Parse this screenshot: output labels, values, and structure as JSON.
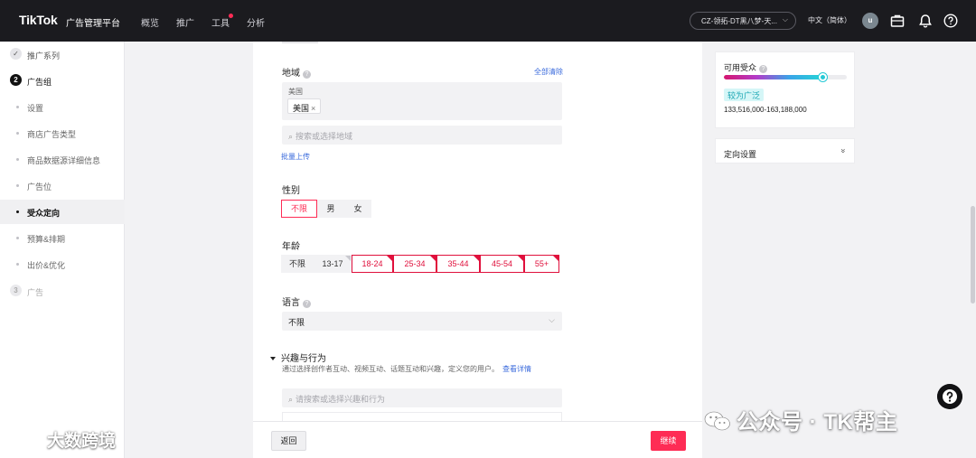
{
  "topbar": {
    "logo": "TikTok",
    "logo_sub": "广告管理平台",
    "nav": [
      "概览",
      "推广",
      "工具",
      "分析"
    ],
    "account": "CZ-领拓-DT黑八梦-天...",
    "language": "中文（简体）",
    "avatar": "u",
    "icons": [
      "briefcase-icon",
      "bell-icon",
      "help-icon"
    ],
    "accent": "#fe2c55"
  },
  "sidebar": {
    "items": [
      {
        "label": "推广系列",
        "step": "✓"
      },
      {
        "label": "广告组",
        "step": "2"
      },
      {
        "label": "设置"
      },
      {
        "label": "商店广告类型"
      },
      {
        "label": "商品数据源详细信息"
      },
      {
        "label": "广告位"
      },
      {
        "label": "受众定向"
      },
      {
        "label": "预算&排期"
      },
      {
        "label": "出价&优化"
      },
      {
        "label": "广告",
        "step": "3"
      }
    ],
    "active": "受众定向"
  },
  "form": {
    "region": {
      "label": "地域",
      "clear_all": "全部清除",
      "group_caption": "美国",
      "tag": "美国",
      "tag_remove": "×",
      "search_placeholder": "搜索或选择地域",
      "bulk_upload": "批量上传"
    },
    "gender": {
      "label": "性别",
      "options": [
        "不限",
        "男",
        "女"
      ],
      "selected": "不限"
    },
    "age": {
      "label": "年龄",
      "options": [
        "不限",
        "13-17",
        "18-24",
        "25-34",
        "35-44",
        "45-54",
        "55+"
      ],
      "selected": [
        "18-24",
        "25-34",
        "35-44",
        "45-54",
        "55+"
      ]
    },
    "language": {
      "label": "语言",
      "value": "不限"
    },
    "interests": {
      "title": "兴趣与行为",
      "description": "通过选择创作者互动、视频互动、话题互动和兴趣，定义您的用户。",
      "details_link": "查看详情",
      "search_placeholder": "请搜索或选择兴趣和行为"
    }
  },
  "footer": {
    "back": "返回",
    "next": "继续"
  },
  "audience": {
    "title": "可用受众",
    "level": 0.8,
    "badge": "较为广泛",
    "range": "133,516,000-163,188,000"
  },
  "targeting": {
    "title": "定向设置",
    "chevron": "»"
  },
  "watermarks": {
    "right": "公众号 · TK帮主",
    "left": "大数跨境"
  }
}
